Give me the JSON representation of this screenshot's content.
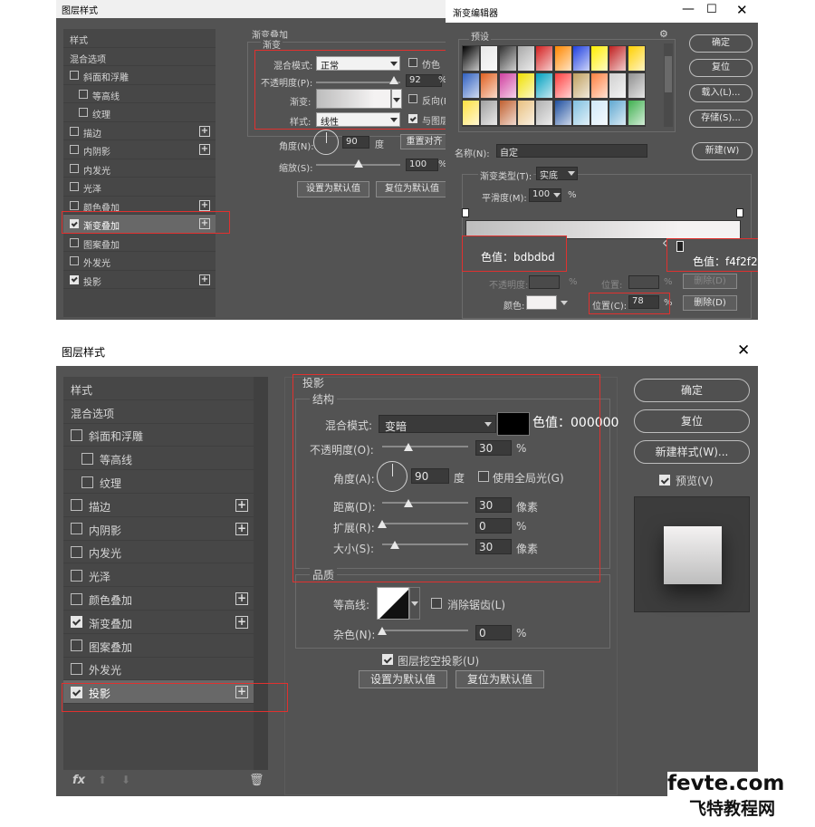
{
  "top_layer_style": {
    "title": "图层样式",
    "sidebar": [
      {
        "label": "样式",
        "checkbox": false,
        "checked": false,
        "plus": false,
        "indent": 0
      },
      {
        "label": "混合选项",
        "checkbox": false,
        "checked": false,
        "plus": false,
        "indent": 0
      },
      {
        "label": "斜面和浮雕",
        "checkbox": true,
        "checked": false,
        "plus": false,
        "indent": 0
      },
      {
        "label": "等高线",
        "checkbox": true,
        "checked": false,
        "plus": false,
        "indent": 1
      },
      {
        "label": "纹理",
        "checkbox": true,
        "checked": false,
        "plus": false,
        "indent": 1
      },
      {
        "label": "描边",
        "checkbox": true,
        "checked": false,
        "plus": true,
        "indent": 0
      },
      {
        "label": "内阴影",
        "checkbox": true,
        "checked": false,
        "plus": true,
        "indent": 0
      },
      {
        "label": "内发光",
        "checkbox": true,
        "checked": false,
        "plus": false,
        "indent": 0
      },
      {
        "label": "光泽",
        "checkbox": true,
        "checked": false,
        "plus": false,
        "indent": 0
      },
      {
        "label": "颜色叠加",
        "checkbox": true,
        "checked": false,
        "plus": true,
        "indent": 0
      },
      {
        "label": "渐变叠加",
        "checkbox": true,
        "checked": true,
        "plus": true,
        "indent": 0,
        "selected": true
      },
      {
        "label": "图案叠加",
        "checkbox": true,
        "checked": false,
        "plus": false,
        "indent": 0
      },
      {
        "label": "外发光",
        "checkbox": true,
        "checked": false,
        "plus": false,
        "indent": 0
      },
      {
        "label": "投影",
        "checkbox": true,
        "checked": true,
        "plus": true,
        "indent": 0
      }
    ],
    "section_title": "渐变叠加",
    "group_title": "渐变",
    "blend_mode_label": "混合模式:",
    "blend_mode_value": "正常",
    "dither_label": "仿色",
    "opacity_label": "不透明度(P):",
    "opacity_value": "92",
    "opacity_unit": "%",
    "opacity_level": 0.92,
    "gradient_label": "渐变:",
    "reverse_label": "反向(R",
    "style_label": "样式:",
    "style_value": "线性",
    "align_label": "与图层",
    "angle_label": "角度(N):",
    "angle_value": "90",
    "angle_unit": "度",
    "reset_align_button": "重置对齐",
    "scale_label": "缩放(S):",
    "scale_value": "100",
    "scale_unit": "%",
    "scale_level": 0.5,
    "set_default_button": "设置为默认值",
    "reset_default_button": "复位为默认值"
  },
  "gradient_editor": {
    "title": "渐变编辑器",
    "presets_label": "预设",
    "gear_icon": "gear-icon",
    "ok_button": "确定",
    "reset_button": "复位",
    "load_button": "载入(L)...",
    "save_button": "存储(S)...",
    "name_label": "名称(N):",
    "name_value": "自定",
    "new_button": "新建(W)",
    "type_label": "渐变类型(T):",
    "type_value": "实底",
    "smooth_label": "平滑度(M):",
    "smooth_value": "100",
    "smooth_unit": "%",
    "stops_group_label": "色标",
    "opacity_label": "不透明度:",
    "opacity_unit": "%",
    "location_label": "位置:",
    "location_unit": "%",
    "delete_button": "删除(D)",
    "color_label": "颜色:",
    "color_location_label": "位置(C):",
    "color_location_value": "78",
    "color_location_unit": "%",
    "left_color_note": "色值：bdbdbd",
    "right_color_note": "色值：f4f2f2",
    "gradient_start": "#bdbdbd",
    "gradient_end": "#f4f2f2",
    "stop_position": 0.78,
    "preset_swatches": [
      "#000000",
      "#e8e8e8",
      "#333333",
      "#aaaaaa",
      "#d42020",
      "#ff8800",
      "#2040e0",
      "#ffee00",
      "#c02020",
      "#ffd000",
      "#3060c0",
      "#e06020",
      "#d040a0",
      "#f0e000",
      "#00a0c0",
      "#ff4040",
      "#c0a060",
      "#ff8040",
      "#d0d0d0",
      "#909090",
      "#ffe040",
      "#a0a0a0",
      "#c06030",
      "#e8c080",
      "#b0b0b0",
      "#2050a0",
      "#80c0e0",
      "#d0e8f8",
      "#60a8d0",
      "#40b050"
    ]
  },
  "bottom_layer_style": {
    "title": "图层样式",
    "close_icon": "close-icon",
    "sidebar": [
      {
        "label": "样式",
        "checkbox": false,
        "checked": false,
        "plus": false,
        "indent": 0
      },
      {
        "label": "混合选项",
        "checkbox": false,
        "checked": false,
        "plus": false,
        "indent": 0
      },
      {
        "label": "斜面和浮雕",
        "checkbox": true,
        "checked": false,
        "plus": false,
        "indent": 0
      },
      {
        "label": "等高线",
        "checkbox": true,
        "checked": false,
        "plus": false,
        "indent": 1
      },
      {
        "label": "纹理",
        "checkbox": true,
        "checked": false,
        "plus": false,
        "indent": 1
      },
      {
        "label": "描边",
        "checkbox": true,
        "checked": false,
        "plus": true,
        "indent": 0
      },
      {
        "label": "内阴影",
        "checkbox": true,
        "checked": false,
        "plus": true,
        "indent": 0
      },
      {
        "label": "内发光",
        "checkbox": true,
        "checked": false,
        "plus": false,
        "indent": 0
      },
      {
        "label": "光泽",
        "checkbox": true,
        "checked": false,
        "plus": false,
        "indent": 0
      },
      {
        "label": "颜色叠加",
        "checkbox": true,
        "checked": false,
        "plus": true,
        "indent": 0
      },
      {
        "label": "渐变叠加",
        "checkbox": true,
        "checked": true,
        "plus": true,
        "indent": 0
      },
      {
        "label": "图案叠加",
        "checkbox": true,
        "checked": false,
        "plus": false,
        "indent": 0
      },
      {
        "label": "外发光",
        "checkbox": true,
        "checked": false,
        "plus": false,
        "indent": 0
      },
      {
        "label": "投影",
        "checkbox": true,
        "checked": true,
        "plus": true,
        "indent": 0,
        "selected": true
      }
    ],
    "section_title": "投影",
    "structure_title": "结构",
    "blend_mode_label": "混合模式:",
    "blend_mode_value": "变暗",
    "shadow_color": "#000000",
    "color_note": "色值：000000",
    "opacity_label": "不透明度(O):",
    "opacity_value": "30",
    "opacity_level": 0.3,
    "unit_percent": "%",
    "angle_label": "角度(A):",
    "angle_value": "90",
    "angle_unit": "度",
    "global_light_label": "使用全局光(G)",
    "distance_label": "距离(D):",
    "distance_value": "30",
    "distance_level": 0.3,
    "unit_px": "像素",
    "spread_label": "扩展(R):",
    "spread_value": "0",
    "spread_level": 0,
    "size_label": "大小(S):",
    "size_value": "30",
    "size_level": 0.15,
    "quality_title": "品质",
    "contour_label": "等高线:",
    "antialias_label": "消除锯齿(L)",
    "noise_label": "杂色(N):",
    "noise_value": "0",
    "noise_level": 0,
    "knockout_label": "图层挖空投影(U)",
    "set_default_button": "设置为默认值",
    "reset_default_button": "复位为默认值",
    "ok_button": "确定",
    "reset_button": "复位",
    "new_style_button": "新建样式(W)...",
    "preview_label": "预览(V)",
    "fx_label": "fx",
    "watermark_line1": "fevte.com",
    "watermark_line2": "飞特教程网"
  }
}
